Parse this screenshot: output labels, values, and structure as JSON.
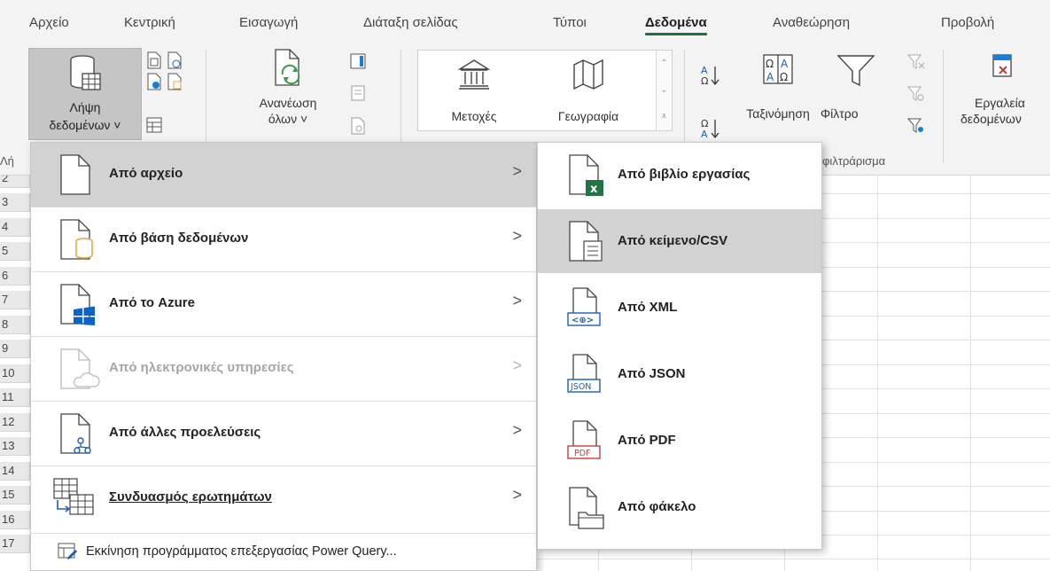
{
  "tabs": [
    {
      "label": "Αρχείο"
    },
    {
      "label": "Κεντρική"
    },
    {
      "label": "Εισαγωγή"
    },
    {
      "label": "Διάταξη σελίδας"
    },
    {
      "label": "Τύποι"
    },
    {
      "label": "Δεδομένα"
    },
    {
      "label": "Αναθεώρηση"
    },
    {
      "label": "Προβολή"
    }
  ],
  "ribbon": {
    "get_data_line1": "Λήψη",
    "get_data_line2": "δεδομένων ˅",
    "refresh_line1": "Ανανέωση",
    "refresh_line2": "όλων ˅",
    "stocks": "Μετοχές",
    "geography": "Γεωγραφία",
    "sort": "Ταξινόμηση",
    "filter": "Φίλτρο",
    "tools_line1": "Εργαλεία",
    "tools_line2": "δεδομένων",
    "group_get_partial": "Λή",
    "group_filter_partial": "φιλτράρισμα"
  },
  "rows": [
    "2",
    "3",
    "4",
    "5",
    "6",
    "7",
    "8",
    "9",
    "10",
    "11",
    "12",
    "13",
    "14",
    "15",
    "16",
    "17"
  ],
  "menu_main": {
    "items": [
      {
        "label": "Από αρχείο",
        "chevron": ">"
      },
      {
        "label": "Από βάση δεδομένων",
        "chevron": ">"
      },
      {
        "label": "Από το Azure",
        "chevron": ">"
      },
      {
        "label": "Από ηλεκτρονικές υπηρεσίες",
        "chevron": ">"
      },
      {
        "label": "Από άλλες προελεύσεις",
        "chevron": ">"
      },
      {
        "label": "Συνδυασμός ερωτημάτων",
        "chevron": ">"
      }
    ],
    "footer": "Εκκίνηση προγράμματος επεξεργασίας Power Query..."
  },
  "menu_sub": {
    "items": [
      {
        "label": "Από βιβλίο εργασίας"
      },
      {
        "label": "Από κείμενο/CSV"
      },
      {
        "label": "Από XML"
      },
      {
        "label": "Από JSON"
      },
      {
        "label": "Από PDF"
      },
      {
        "label": "Από φάκελο"
      }
    ],
    "badges": {
      "excel": "x",
      "xml": "<⊕>",
      "json": "JSON",
      "pdf": "PDF"
    }
  },
  "colors": {
    "accent_green": "#1e7145",
    "hover_gray": "#d2d2d2",
    "excel_green": "#217346",
    "pdf_red": "#c43e3e",
    "azure_blue": "#0a64c8",
    "xml_blue": "#1a5fb4",
    "database_orange": "#e8a33d",
    "refresh_green": "#3c9a4a"
  },
  "icons": {
    "get_data": "database-table-icon",
    "refresh": "refresh-document-icon",
    "stocks": "bank-building-icon",
    "geography": "map-icon",
    "sort_az": "sort-az-icon",
    "sort_custom": "sort-custom-icon",
    "filter": "funnel-icon",
    "tools": "data-tools-icon",
    "file": "file-icon",
    "database": "database-icon",
    "azure": "azure-windows-icon",
    "online": "cloud-document-icon",
    "other": "network-document-icon",
    "combine": "combine-tables-icon",
    "power_query": "power-query-editor-icon",
    "workbook": "excel-workbook-icon",
    "text_csv": "text-document-icon",
    "xml": "xml-document-icon",
    "json": "json-document-icon",
    "pdf": "pdf-document-icon",
    "folder": "folder-document-icon"
  }
}
